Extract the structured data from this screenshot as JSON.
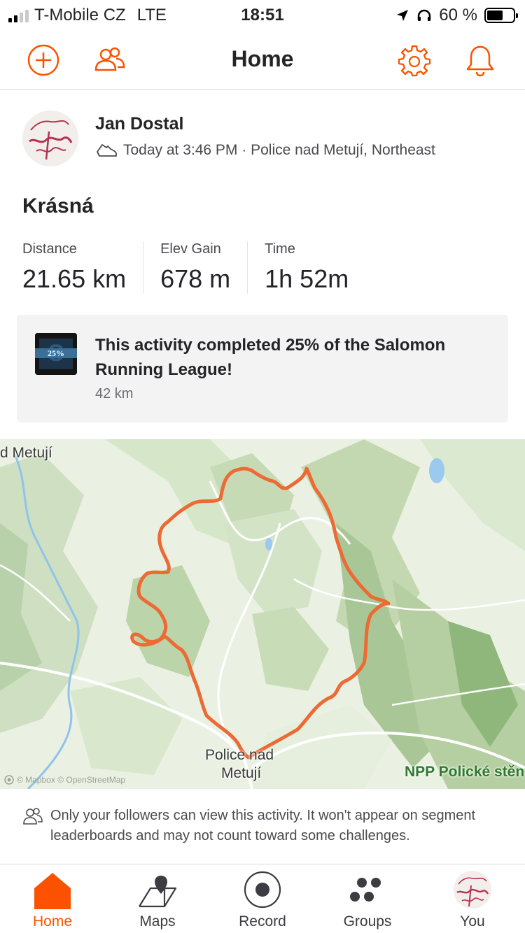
{
  "status_bar": {
    "carrier": "T-Mobile CZ",
    "network": "LTE",
    "time": "18:51",
    "battery": "60 %",
    "battery_level": 0.6
  },
  "nav": {
    "title": "Home",
    "icons": [
      "add-icon",
      "friends-icon",
      "settings-gear-icon",
      "notifications-bell-icon"
    ]
  },
  "activity": {
    "athlete_name": "Jan Dostal",
    "meta": "Today at 3:46 PM · Police nad Metují, Northeast",
    "title": "Krásná",
    "stats": [
      {
        "label": "Distance",
        "value": "21.65 km"
      },
      {
        "label": "Elev Gain",
        "value": "678 m"
      },
      {
        "label": "Time",
        "value": "1h 52m"
      }
    ]
  },
  "challenge": {
    "title": "This activity completed 25% of the Salomon Running League!",
    "subtitle": "42 km",
    "badge_percent": "25%"
  },
  "map": {
    "labels": {
      "top_left": "d Metují",
      "town_line1": "Police nad",
      "town_line2": "Metují",
      "reserve": "NPP Polické stěn"
    },
    "attribution": "© Mapbox © OpenStreetMap",
    "route_color": "#ec6a34"
  },
  "privacy_note": "Only your followers can view this activity. It won't appear on segment leaderboards and may not count toward some challenges.",
  "tabs": [
    {
      "label": "Home",
      "icon": "home-icon",
      "active": true
    },
    {
      "label": "Maps",
      "icon": "maps-icon",
      "active": false
    },
    {
      "label": "Record",
      "icon": "record-icon",
      "active": false
    },
    {
      "label": "Groups",
      "icon": "groups-icon",
      "active": false
    },
    {
      "label": "You",
      "icon": "profile-avatar",
      "active": false
    }
  ],
  "colors": {
    "accent": "#fc5200",
    "text": "#242428",
    "card_bg": "#f3f3f4"
  }
}
